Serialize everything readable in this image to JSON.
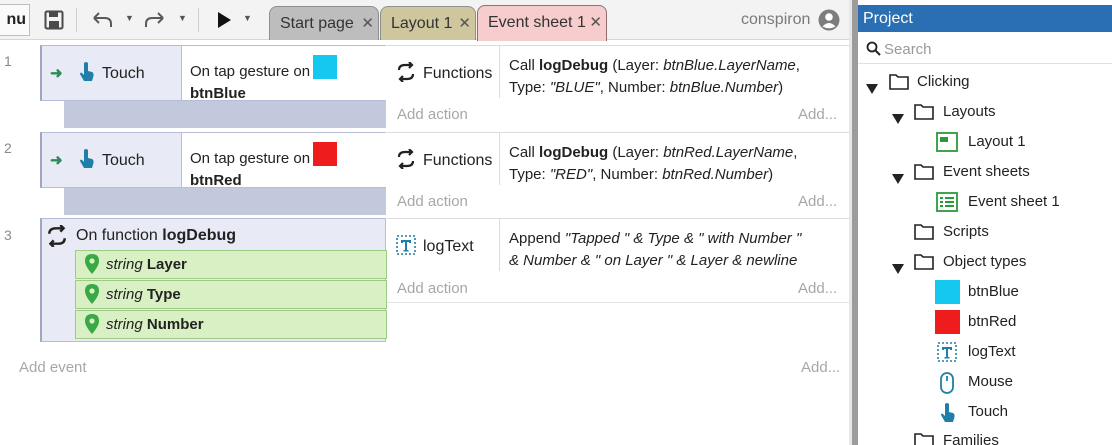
{
  "toolbar": {
    "menu_label": "nu",
    "tabs": [
      {
        "label": "Start page",
        "close": "✕"
      },
      {
        "label": "Layout 1",
        "close": "✕"
      },
      {
        "label": "Event sheet 1",
        "close": "✕"
      }
    ],
    "user": "conspiron"
  },
  "events": [
    {
      "number": "1",
      "object": "Touch",
      "condition_prefix": "On tap gesture on",
      "condition_object": "btnBlue",
      "swatch_color": "#14c8f0",
      "action_object": "Functions",
      "action_call": "Call ",
      "action_func": "logDebug",
      "action_line1_params": " (Layer: ",
      "action_line1_ital": "btnBlue.LayerName",
      "action_line1_end": ",",
      "action_line2_type_label": "Type: ",
      "action_line2_type_val": "\"BLUE\"",
      "action_line2_num_label": ", Number: ",
      "action_line2_num_val": "btnBlue.Number",
      "action_line2_end": ")",
      "add_action": "Add action",
      "add_right": "Add..."
    },
    {
      "number": "2",
      "object": "Touch",
      "condition_prefix": "On tap gesture on",
      "condition_object": "btnRed",
      "swatch_color": "#ee1c1c",
      "action_object": "Functions",
      "action_call": "Call ",
      "action_func": "logDebug",
      "action_line1_params": " (Layer: ",
      "action_line1_ital": "btnRed.LayerName",
      "action_line1_end": ",",
      "action_line2_type_label": "Type: ",
      "action_line2_type_val": "\"RED\"",
      "action_line2_num_label": ", Number: ",
      "action_line2_num_val": "btnRed.Number",
      "action_line2_end": ")",
      "add_action": "Add action",
      "add_right": "Add..."
    }
  ],
  "function_event": {
    "number": "3",
    "prefix": "On function ",
    "name": "logDebug",
    "params": [
      {
        "type": "string",
        "name": "Layer"
      },
      {
        "type": "string",
        "name": "Type"
      },
      {
        "type": "string",
        "name": "Number"
      }
    ],
    "action_object": "logText",
    "action_verb": "Append ",
    "action_line1": "\"Tapped \" & Type & \" with Number \"",
    "action_line2": "& Number & \" on Layer \" & Layer & newline",
    "add_action": "Add action",
    "add_right": "Add..."
  },
  "add_event": "Add event",
  "add_event_right": "Add...",
  "project": {
    "title": "Project",
    "search_placeholder": "Search",
    "tree": [
      {
        "label": "Clicking",
        "icon": "folder-icon"
      },
      {
        "label": "Layouts",
        "icon": "folder-icon"
      },
      {
        "label": "Layout 1",
        "icon": "layout-icon"
      },
      {
        "label": "Event sheets",
        "icon": "folder-icon"
      },
      {
        "label": "Event sheet 1",
        "icon": "event-sheet-icon"
      },
      {
        "label": "Scripts",
        "icon": "folder-icon"
      },
      {
        "label": "Object types",
        "icon": "folder-icon"
      },
      {
        "label": "btnBlue",
        "icon": "blue-swatch-icon",
        "color": "#14c8f0"
      },
      {
        "label": "btnRed",
        "icon": "red-swatch-icon",
        "color": "#ee1c1c"
      },
      {
        "label": "logText",
        "icon": "text-object-icon"
      },
      {
        "label": "Mouse",
        "icon": "mouse-icon"
      },
      {
        "label": "Touch",
        "icon": "touch-icon"
      },
      {
        "label": "Families",
        "icon": "folder-icon"
      }
    ]
  },
  "colors": {
    "accent": "#2a6fb3",
    "condition_bg": "#e8ebf5",
    "param_bg": "#d8f0c4",
    "tab_event_bg": "#f6cccc",
    "tab_layout_bg": "#cec79d"
  }
}
